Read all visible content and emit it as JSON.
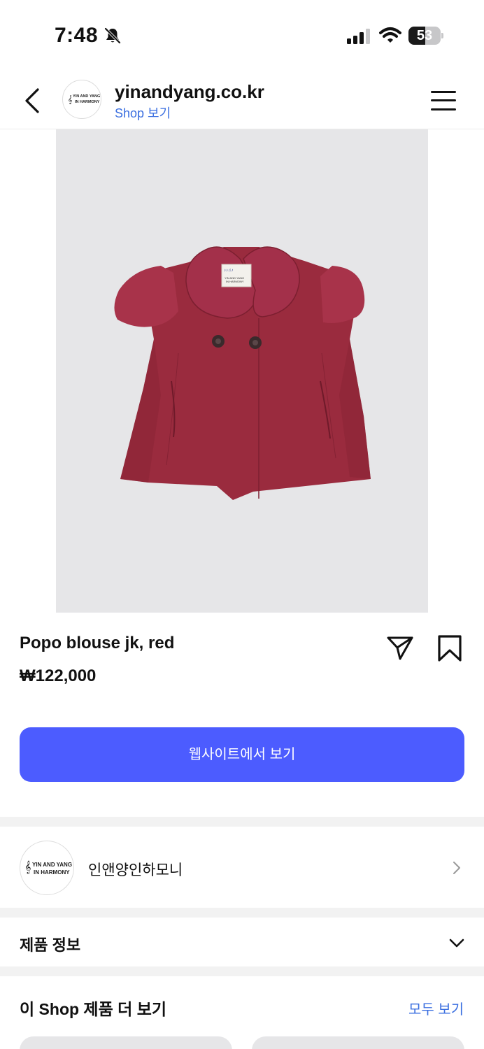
{
  "status_bar": {
    "time": "7:48",
    "battery": "53",
    "battery_level": 0.53
  },
  "header": {
    "domain": "yinandyang.co.kr",
    "shop_link": "Shop 보기",
    "logo_text_line1": "YIN AND YANG",
    "logo_text_line2": "IN HARMONY"
  },
  "product": {
    "image_label_line1": "YIN AND YANG",
    "image_label_line2": "IN HARMONY",
    "name": "Popo blouse jk, red",
    "price": "₩122,000",
    "cta_label": "웹사이트에서 보기"
  },
  "merchant": {
    "name": "인앤양인하모니",
    "logo_text_line1": "YIN AND YANG",
    "logo_text_line2": "IN HARMONY"
  },
  "product_info": {
    "title": "제품 정보"
  },
  "more_from_shop": {
    "title": "이 Shop 제품 더 보기",
    "see_all": "모두 보기"
  },
  "colors": {
    "accent": "#4c5cff",
    "link": "#3b6fe0",
    "garment": "#9a2b3e"
  }
}
